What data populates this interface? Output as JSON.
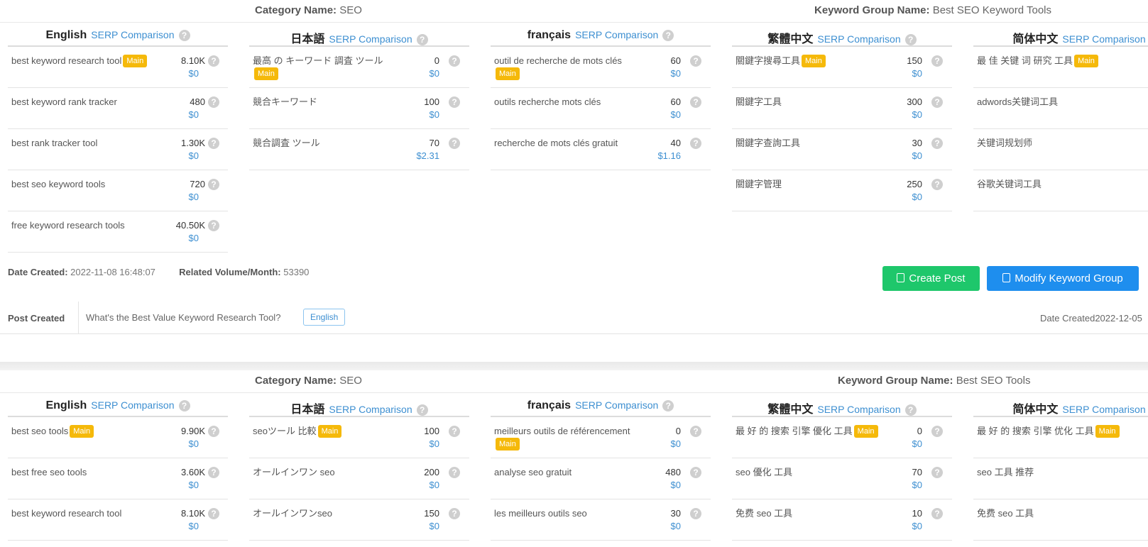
{
  "labels": {
    "category": "Category Name:",
    "keyword_group": "Keyword Group Name:",
    "serp": "SERP Comparison",
    "main_badge": "Main",
    "help": "?",
    "date_created": "Date Created:",
    "related_volume": "Related Volume/Month:",
    "post_created": "Post Created",
    "create_post": "Create Post",
    "modify_group": "Modify Keyword Group",
    "post_date_label": "Date Created"
  },
  "groups": [
    {
      "category": "SEO",
      "keyword_group": "Best SEO Keyword Tools",
      "date_created": "2022-11-08 16:48:07",
      "related_volume": "53390",
      "post": {
        "title": "What's the Best Value Keyword Research Tool?",
        "lang": "English",
        "date": "2022-12-05"
      },
      "columns": [
        {
          "lang": "English",
          "rows": [
            {
              "kw": "best keyword research tool",
              "main": true,
              "vol": "8.10K",
              "cpc": "$0"
            },
            {
              "kw": "best keyword rank tracker",
              "main": false,
              "vol": "480",
              "cpc": "$0"
            },
            {
              "kw": "best rank tracker tool",
              "main": false,
              "vol": "1.30K",
              "cpc": "$0"
            },
            {
              "kw": "best seo keyword tools",
              "main": false,
              "vol": "720",
              "cpc": "$0"
            },
            {
              "kw": "free keyword research tools",
              "main": false,
              "vol": "40.50K",
              "cpc": "$0"
            }
          ]
        },
        {
          "lang": "日本語",
          "rows": [
            {
              "kw": "最高 の キーワード 調査 ツール",
              "main": true,
              "vol": "0",
              "cpc": "$0"
            },
            {
              "kw": "競合キーワード",
              "main": false,
              "vol": "100",
              "cpc": "$0"
            },
            {
              "kw": "競合調査 ツール",
              "main": false,
              "vol": "70",
              "cpc": "$2.31"
            }
          ]
        },
        {
          "lang": "français",
          "rows": [
            {
              "kw": "outil de recherche de mots clés",
              "main": true,
              "vol": "60",
              "cpc": "$0"
            },
            {
              "kw": "outils recherche mots clés",
              "main": false,
              "vol": "60",
              "cpc": "$0"
            },
            {
              "kw": "recherche de mots clés gratuit",
              "main": false,
              "vol": "40",
              "cpc": "$1.16"
            }
          ]
        },
        {
          "lang": "繁體中文",
          "rows": [
            {
              "kw": "關鍵字搜尋工具",
              "main": true,
              "vol": "150",
              "cpc": "$0"
            },
            {
              "kw": "關鍵字工具",
              "main": false,
              "vol": "300",
              "cpc": "$0"
            },
            {
              "kw": "關鍵字查詢工具",
              "main": false,
              "vol": "30",
              "cpc": "$0"
            },
            {
              "kw": "關鍵字管理",
              "main": false,
              "vol": "250",
              "cpc": "$0"
            }
          ]
        },
        {
          "lang": "简体中文",
          "rows": [
            {
              "kw": "最 佳 关键 词 研究 工具",
              "main": true,
              "vol": "",
              "cpc": ""
            },
            {
              "kw": "adwords关键词工具",
              "main": false,
              "vol": "",
              "cpc": ""
            },
            {
              "kw": "关键词规划师",
              "main": false,
              "vol": "",
              "cpc": ""
            },
            {
              "kw": "谷歌关键词工具",
              "main": false,
              "vol": "",
              "cpc": ""
            }
          ]
        }
      ]
    },
    {
      "category": "SEO",
      "keyword_group": "Best SEO Tools",
      "columns": [
        {
          "lang": "English",
          "rows": [
            {
              "kw": "best seo tools",
              "main": true,
              "vol": "9.90K",
              "cpc": "$0"
            },
            {
              "kw": "best free seo tools",
              "main": false,
              "vol": "3.60K",
              "cpc": "$0"
            },
            {
              "kw": "best keyword research tool",
              "main": false,
              "vol": "8.10K",
              "cpc": "$0"
            }
          ]
        },
        {
          "lang": "日本語",
          "rows": [
            {
              "kw": "seoツール 比較",
              "main": true,
              "vol": "100",
              "cpc": "$0"
            },
            {
              "kw": "オールインワン seo",
              "main": false,
              "vol": "200",
              "cpc": "$0"
            },
            {
              "kw": "オールインワンseo",
              "main": false,
              "vol": "150",
              "cpc": "$0"
            }
          ]
        },
        {
          "lang": "français",
          "rows": [
            {
              "kw": "meilleurs outils de référencement",
              "main": true,
              "vol": "0",
              "cpc": "$0"
            },
            {
              "kw": "analyse seo gratuit",
              "main": false,
              "vol": "480",
              "cpc": "$0"
            },
            {
              "kw": "les meilleurs outils seo",
              "main": false,
              "vol": "30",
              "cpc": "$0"
            }
          ]
        },
        {
          "lang": "繁體中文",
          "rows": [
            {
              "kw": "最 好 的 搜索 引擎 優化 工具",
              "main": true,
              "vol": "0",
              "cpc": "$0"
            },
            {
              "kw": "seo 優化 工具",
              "main": false,
              "vol": "70",
              "cpc": "$0"
            },
            {
              "kw": "免费 seo 工具",
              "main": false,
              "vol": "10",
              "cpc": "$0"
            }
          ]
        },
        {
          "lang": "简体中文",
          "rows": [
            {
              "kw": "最 好 的 搜索 引擎 优化 工具",
              "main": true,
              "vol": "",
              "cpc": ""
            },
            {
              "kw": "seo 工具 推荐",
              "main": false,
              "vol": "",
              "cpc": ""
            },
            {
              "kw": "免费 seo 工具",
              "main": false,
              "vol": "",
              "cpc": ""
            }
          ]
        }
      ]
    }
  ]
}
